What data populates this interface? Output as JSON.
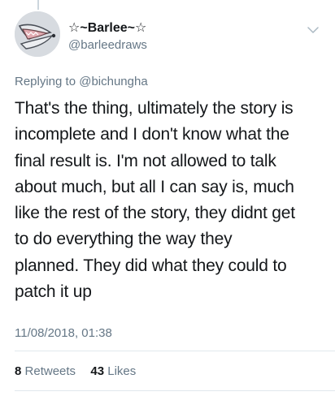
{
  "tweet": {
    "author": {
      "display_name": "☆~Barlee~☆",
      "handle": "@barleedraws",
      "avatar_icon": "avatar-drawing-icon"
    },
    "reply": {
      "prefix": "Replying to",
      "to_user": "@bichungha"
    },
    "text_lines": [
      "That's the thing, ultimately the story is",
      "incomplete and I don't know what the",
      "final result is. I'm not allowed to talk",
      "about much, but all I can say is, much",
      "like the rest of the story, they didnt get",
      "to do everything the way they",
      "planned. They did what they could to",
      "patch it up"
    ],
    "timestamp": "11/08/2018, 01:38",
    "stats": {
      "retweets_count": "8",
      "retweets_label": "Retweets",
      "likes_count": "43",
      "likes_label": "Likes"
    },
    "menu_icon": "chevron-down-icon"
  }
}
